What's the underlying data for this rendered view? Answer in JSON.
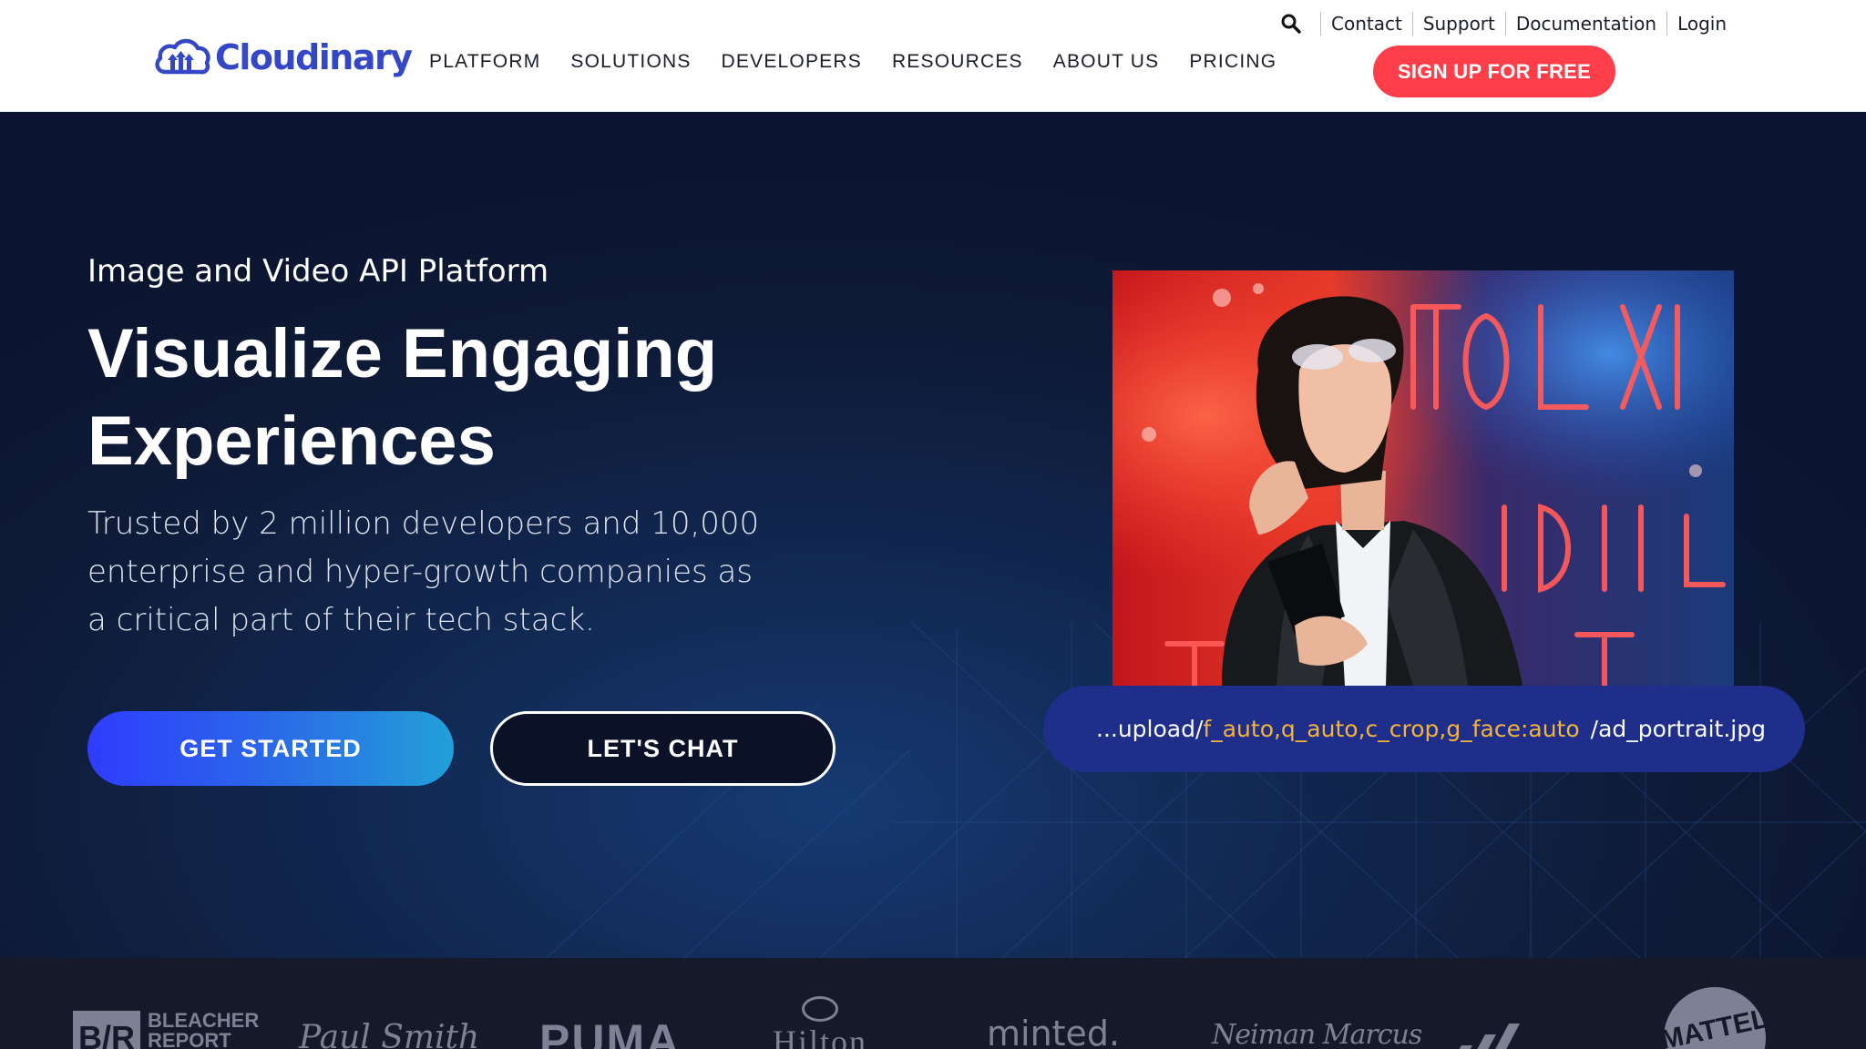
{
  "brand": {
    "name": "Cloudinary",
    "accent": "#3448c5",
    "cta_color": "#ff3e4a"
  },
  "nav": {
    "items": [
      "PLATFORM",
      "SOLUTIONS",
      "DEVELOPERS",
      "RESOURCES",
      "ABOUT US",
      "PRICING"
    ]
  },
  "utility": {
    "search_icon": "search-icon",
    "links": [
      "Contact",
      "Support",
      "Documentation",
      "Login"
    ],
    "signup_label": "SIGN UP FOR FREE"
  },
  "hero": {
    "eyebrow": "Image and Video API Platform",
    "headline_line1": "Visualize Engaging",
    "headline_line2": "Experiences",
    "subtext": "Trusted by 2 million developers and 10,000 enterprise and hyper-growth companies as a critical part of their tech stack.",
    "primary_button": "GET STARTED",
    "secondary_button": "LET'S CHAT",
    "url": {
      "prefix": "...upload/",
      "transform": "f_auto,q_auto,c_crop,g_face:auto",
      "suffix": "/ad_portrait.jpg"
    }
  },
  "customer_logos": {
    "bleacher_mark": "B/R",
    "bleacher_line1": "BLEACHER",
    "bleacher_line2": "REPORT",
    "paul_smith": "Paul Smith",
    "puma": "PUMA",
    "hilton": "Hilton",
    "minted": "minted.",
    "neiman": "Neiman Marcus",
    "adidas": "adidas-logo",
    "mattel": "MATTEL"
  }
}
